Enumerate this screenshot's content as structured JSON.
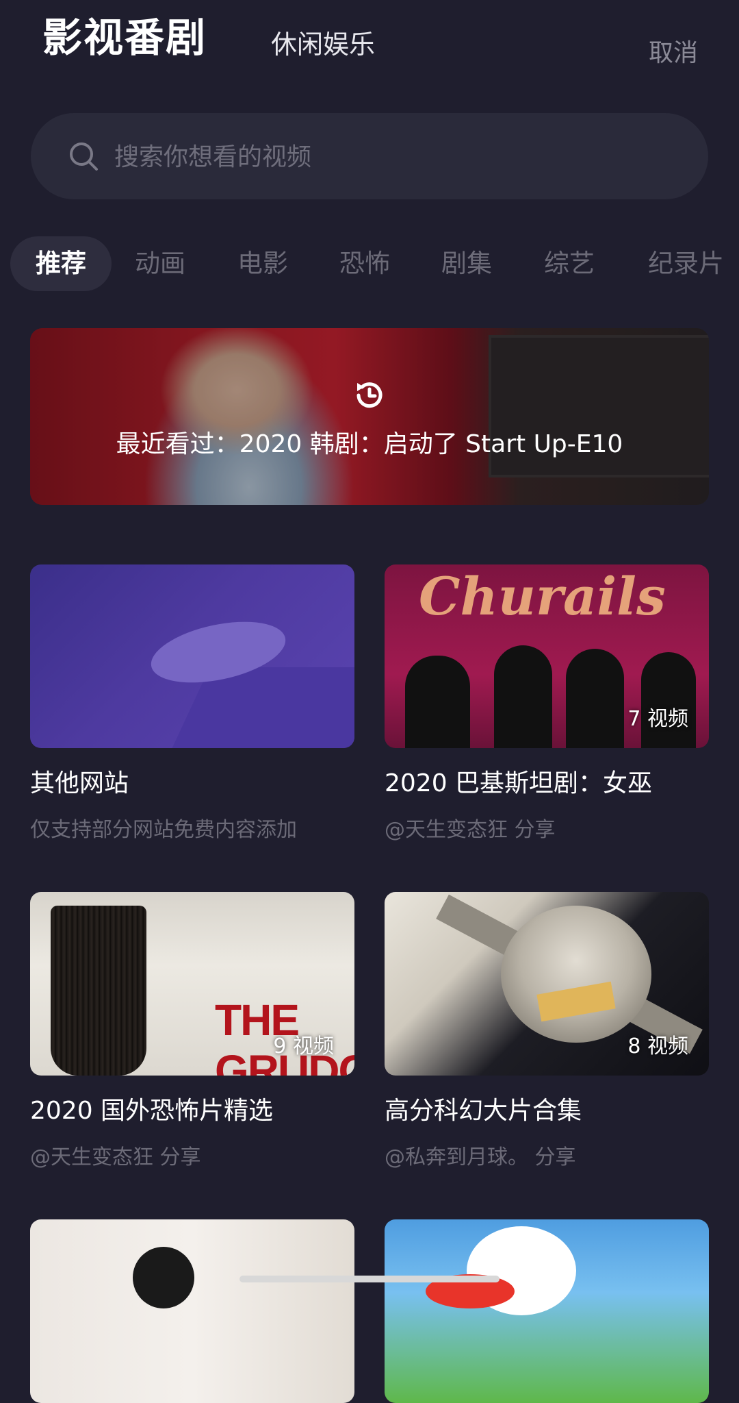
{
  "header": {
    "title": "影视番剧",
    "subtitle": "休闲娱乐",
    "cancel_label": "取消"
  },
  "search": {
    "placeholder": "搜索你想看的视频",
    "icon": "search-icon"
  },
  "tabs": [
    {
      "label": "推荐",
      "active": true
    },
    {
      "label": "动画",
      "active": false
    },
    {
      "label": "电影",
      "active": false
    },
    {
      "label": "恐怖",
      "active": false
    },
    {
      "label": "剧集",
      "active": false
    },
    {
      "label": "综艺",
      "active": false
    },
    {
      "label": "纪录片",
      "active": false
    }
  ],
  "recent": {
    "icon": "history-icon",
    "text": "最近看过：2020 韩剧：启动了 Start Up-E10"
  },
  "cards": [
    {
      "title": "其他网站",
      "subtitle": "仅支持部分网站免费内容添加",
      "count": ""
    },
    {
      "title": "2020 巴基斯坦剧：女巫",
      "subtitle": "@天生变态狂 分享",
      "count": "7 视频",
      "poster_text": "Churails"
    },
    {
      "title": "2020 国外恐怖片精选",
      "subtitle": "@天生变态狂 分享",
      "count": "9 视频",
      "poster_text": "THE GRUDGE"
    },
    {
      "title": "高分科幻大片合集",
      "subtitle": "@私奔到月球。 分享",
      "count": "8 视频"
    }
  ],
  "colors": {
    "background": "#1f1e2e",
    "search_bg": "#2a2a3a",
    "muted_text": "#6c6b78",
    "accent_text": "#ffffff"
  }
}
